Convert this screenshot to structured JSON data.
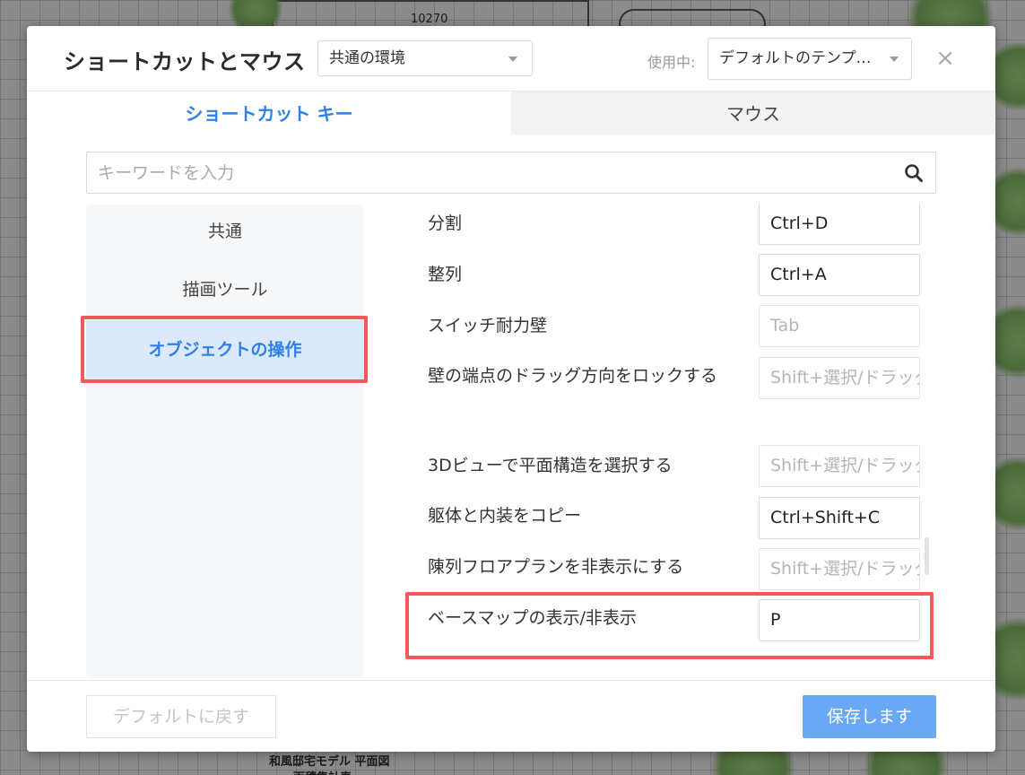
{
  "background": {
    "plan_number": "10270",
    "plan_caption_1": "和風邸宅モデル 平面図",
    "plan_caption_2": "面積集計表"
  },
  "dialog": {
    "title": "ショートカットとマウス",
    "environment_select": "共通の環境",
    "template_label": "使用中:",
    "template_select": "デフォルトのテンプ…",
    "close_symbol": "×"
  },
  "tabs": [
    {
      "label": "ショートカット キー",
      "active": true
    },
    {
      "label": "マウス",
      "active": false
    }
  ],
  "search": {
    "placeholder": "キーワードを入力",
    "value": ""
  },
  "categories": [
    {
      "label": "共通",
      "active": false
    },
    {
      "label": "描画ツール",
      "active": false
    },
    {
      "label": "オブジェクトの操作",
      "active": true
    }
  ],
  "shortcuts": [
    {
      "label": "分割",
      "key": "Ctrl+D",
      "placeholder": false
    },
    {
      "label": "整列",
      "key": "Ctrl+A",
      "placeholder": false
    },
    {
      "label": "スイッチ耐力壁",
      "key": "Tab",
      "placeholder": true
    },
    {
      "label": "壁の端点のドラッグ方向をロックする",
      "key": "Shift+選択/ドラッグ",
      "placeholder": true
    },
    {
      "label": "3Dビューで平面構造を選択する",
      "key": "Shift+選択/ドラッグ",
      "placeholder": true
    },
    {
      "label": "躯体と内装をコピー",
      "key": "Ctrl+Shift+C",
      "placeholder": false
    },
    {
      "label": "陳列フロアプランを非表示にする",
      "key": "Shift+選択/ドラッグ",
      "placeholder": true
    },
    {
      "label": "ベースマップの表示/非表示",
      "key": "P",
      "placeholder": false
    }
  ],
  "footer": {
    "reset_label": "デフォルトに戻す",
    "save_label": "保存します"
  },
  "colors": {
    "accent": "#2f80e8",
    "highlight": "#f05a5a",
    "save_button": "#69a8f5"
  }
}
